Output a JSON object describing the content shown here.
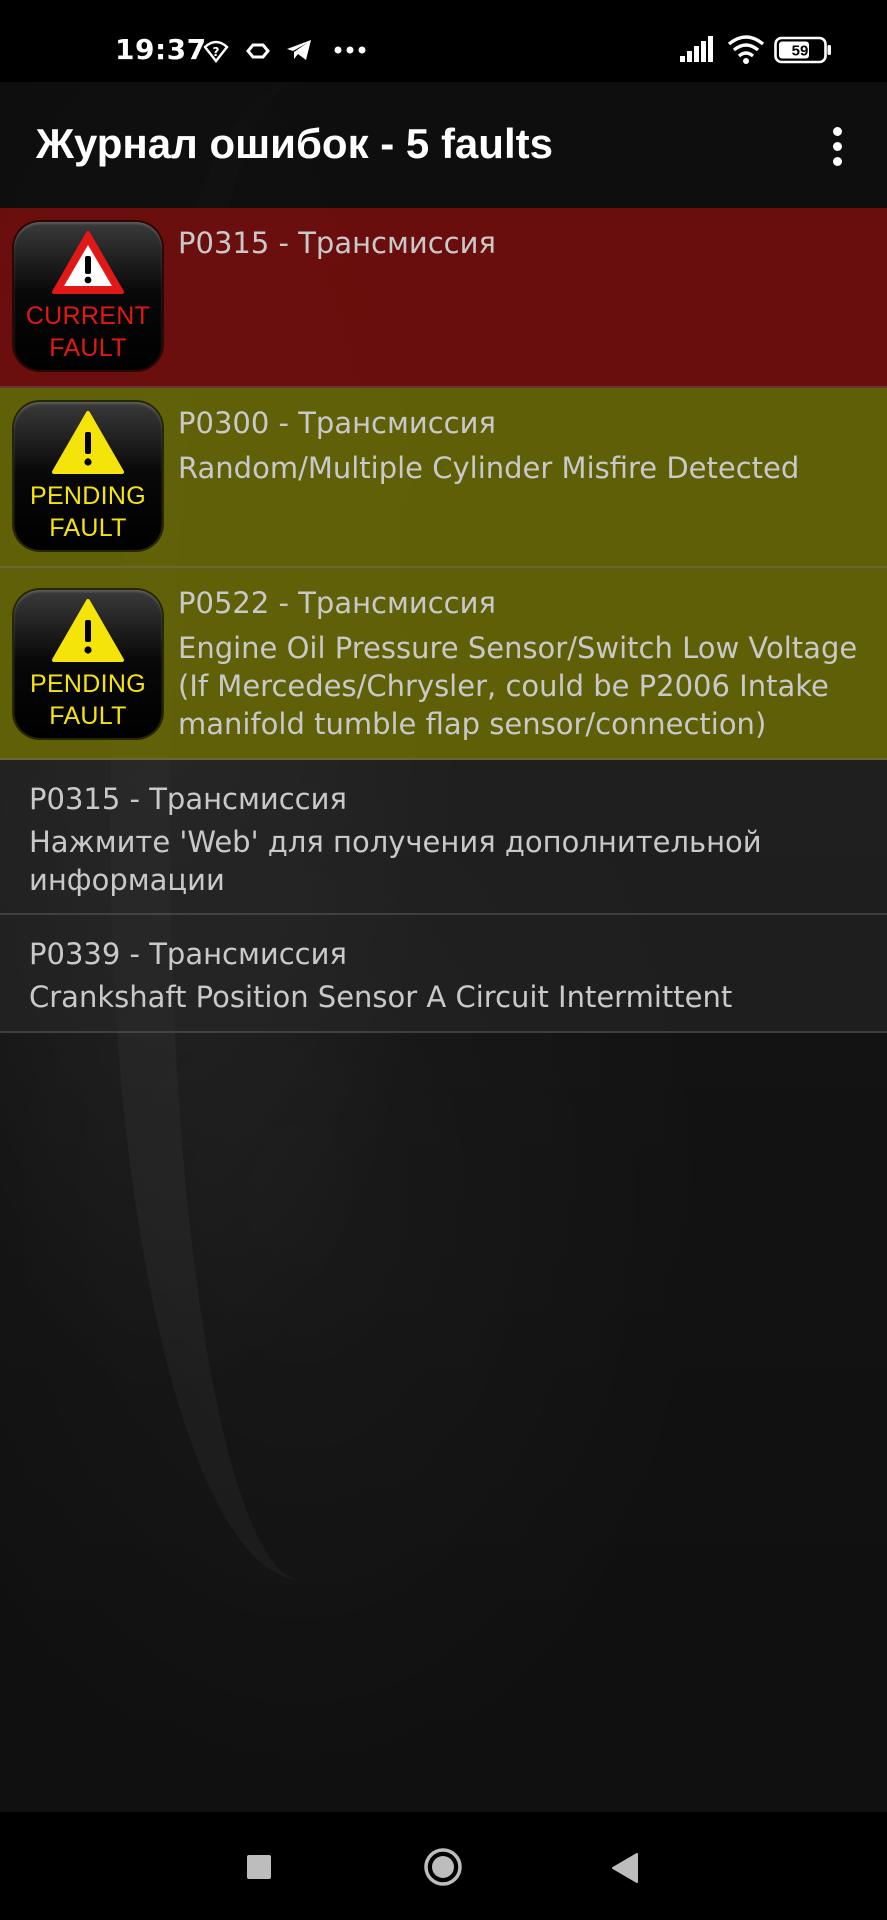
{
  "status_bar": {
    "time": "19:37",
    "battery": "59",
    "icons": [
      "help-wifi-icon",
      "vpn-icon",
      "telegram-icon",
      "more-dots-icon",
      "signal-icon",
      "wifi-icon",
      "battery-icon"
    ]
  },
  "app_bar": {
    "title": "Журнал ошибок - 5 faults",
    "menu_icon": "overflow-menu-icon"
  },
  "faults": [
    {
      "status": "current",
      "badge_line1": "CURRENT",
      "badge_line2": "FAULT",
      "title": "P0315 - Трансмиссия",
      "description": "",
      "color": "#700e0c"
    },
    {
      "status": "pending",
      "badge_line1": "PENDING",
      "badge_line2": "FAULT",
      "title": "P0300 - Трансмиссия",
      "description": "Random/Multiple Cylinder Misfire Detected",
      "color": "#666606"
    },
    {
      "status": "pending",
      "badge_line1": "PENDING",
      "badge_line2": "FAULT",
      "title": "P0522 - Трансмиссия",
      "description": "Engine Oil Pressure Sensor/Switch Low Voltage (If Mercedes/Chrysler, could be P2006 Intake manifold tumble flap sensor/connection)",
      "color": "#666606"
    },
    {
      "status": "history",
      "title": "P0315 - Трансмиссия",
      "description": "Нажмите 'Web' для получения дополнительной информации"
    },
    {
      "status": "history",
      "title": "P0339 - Трансмиссия",
      "description": "Crankshaft Position Sensor A Circuit Intermittent"
    }
  ],
  "nav_bar": {
    "icons": [
      "recents-square-icon",
      "home-circle-icon",
      "back-triangle-icon"
    ]
  }
}
